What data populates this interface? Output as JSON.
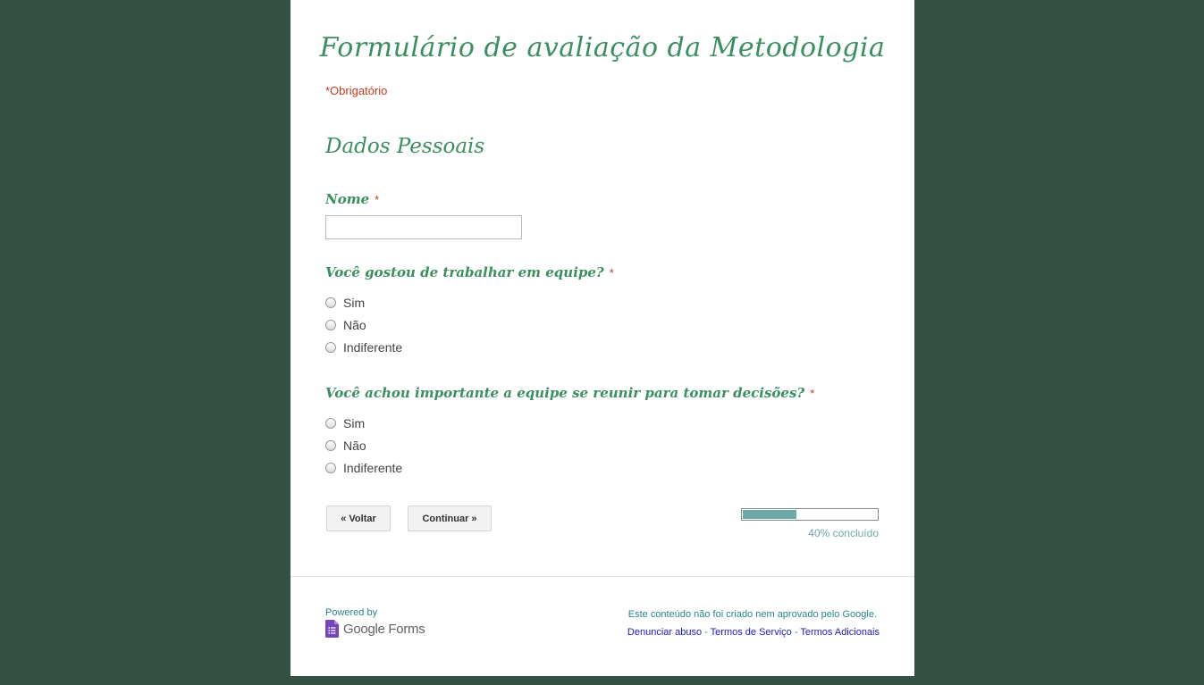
{
  "form": {
    "title": "Formulário de avaliação da Metodologia",
    "required_note": "*Obrigatório",
    "section_title": "Dados Pessoais",
    "required_marker": "*"
  },
  "questions": [
    {
      "label": "Nome",
      "type": "text",
      "value": ""
    },
    {
      "label": "Você gostou de trabalhar em equipe?",
      "type": "radio",
      "options": [
        "Sim",
        "Não",
        "Indiferente"
      ]
    },
    {
      "label": "Você achou importante a equipe se reunir para tomar decisões?",
      "type": "radio",
      "options": [
        "Sim",
        "Não",
        "Indiferente"
      ]
    }
  ],
  "nav": {
    "back_label": "« Voltar",
    "continue_label": "Continuar »"
  },
  "progress": {
    "fraction": 0.4,
    "label": "40% concluído"
  },
  "footer": {
    "powered_by": "Powered by",
    "brand": "Google Forms",
    "disclaimer": "Este conteúdo não foi criado nem aprovado pelo Google.",
    "links": [
      "Denunciar abuso",
      "Termos de Serviço",
      "Termos Adicionais"
    ],
    "separator": " - "
  },
  "colors": {
    "background": "#345244",
    "accent": "#3a8f5f",
    "required": "#c43b1d",
    "progress": "#6ea8a8",
    "brand_icon": "#7248b9"
  }
}
